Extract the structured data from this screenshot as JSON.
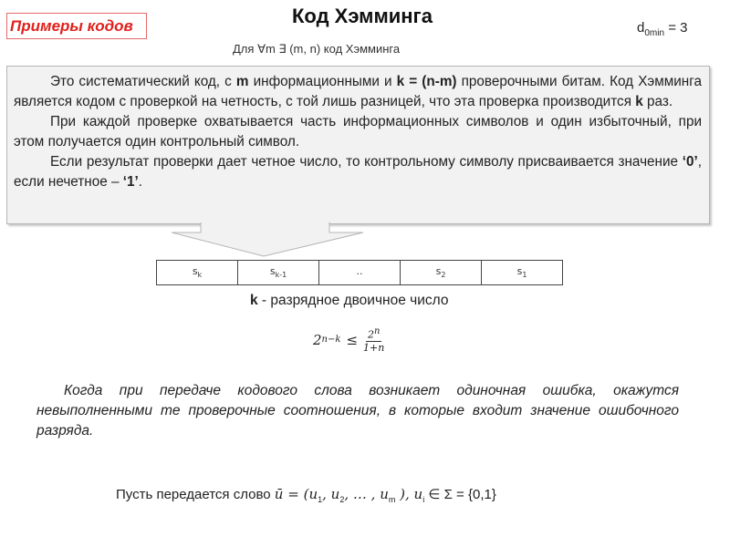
{
  "header": {
    "section_label": "Примеры кодов",
    "title": "Код Хэмминга",
    "subtitle_prefix": "Для",
    "subtitle_math": "∀m ∃ (m, n)",
    "subtitle_suffix": "код Хэмминга",
    "dmin_label": "d",
    "dmin_sub": "0min",
    "dmin_value": "= 3"
  },
  "main_box": {
    "p1_a": "Это систематический код, с ",
    "p1_m": "m",
    "p1_b": " информационными и ",
    "p1_k": "k = (n-m)",
    "p1_c": " проверочными битам. Код Хэмминга является кодом с проверкой на четность, с той лишь разницей, что эта проверка производится ",
    "p1_k2": "k",
    "p1_d": " раз.",
    "p2": "При каждой проверке охватывается часть информационных символов и один избыточный, при этом получается один контрольный символ.",
    "p3_a": "Если результат проверки дает четное число, то контрольному символу присваивается значение ",
    "p3_zero": "‘0’",
    "p3_b": ", если нечетное – ",
    "p3_one": "‘1’",
    "p3_c": "."
  },
  "table": {
    "cells": [
      {
        "base": "s",
        "sub": "k"
      },
      {
        "base": "s",
        "sub": "k-1"
      },
      {
        "base": "..",
        "sub": ""
      },
      {
        "base": "s",
        "sub": "2"
      },
      {
        "base": "s",
        "sub": "1"
      }
    ]
  },
  "k_label": {
    "bold": "k",
    "text": " - разрядное двоичное число"
  },
  "formula": {
    "base": "2",
    "exp": "n−k",
    "rel": "≤",
    "num_base": "2",
    "num_exp": "n",
    "den": "1+n"
  },
  "note": "Когда  при передаче кодового слова возникает одиночная ошибка, окажутся невыполненными те проверочные соотношения, в которые входит значение ошибочного разряда.",
  "word_line": {
    "text": "Пусть передается слово ",
    "u_bar": "ū",
    "eq": " = (",
    "u1": "u",
    "u1_sub": "1",
    "sep1": ", ",
    "u2": "u",
    "u2_sub": "2",
    "sep2": ", … , ",
    "um": "u",
    "um_sub": "m",
    "close": " ),  ",
    "ui": "u",
    "ui_sub": "i",
    "tail": " ∈ Σ = {0,1}"
  }
}
